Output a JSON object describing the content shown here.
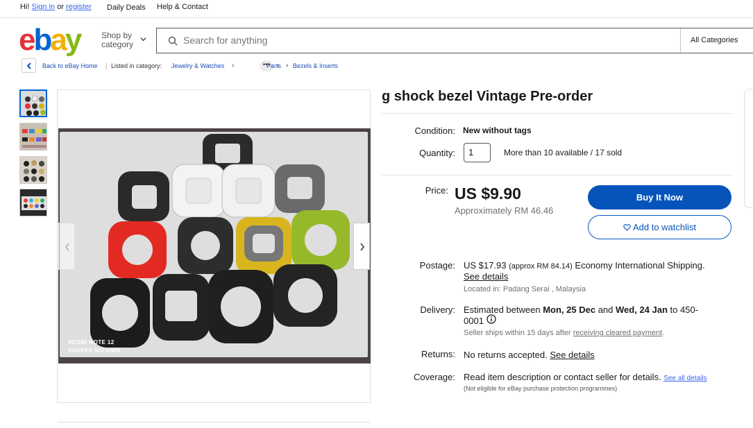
{
  "topbar": {
    "greeting_prefix": "Hi!",
    "sign_in": "Sign in",
    "or": "or",
    "register": "register",
    "daily_deals": "Daily Deals",
    "help_contact": "Help & Contact"
  },
  "header": {
    "shop_by_line1": "Shop by",
    "shop_by_line2": "category",
    "search_placeholder": "Search for anything",
    "category_select": "All Categories"
  },
  "breadcrumb": {
    "back": "Back to eBay Home",
    "listed_in": "Listed in category:",
    "cat1": "Jewelry & Watches",
    "dots": "•••",
    "cat2": "Parts",
    "cat3": "Bezels & Inserts"
  },
  "gallery": {
    "watermark_line1": "REDMI NOTE 12",
    "watermark_line2": "SHOPEE:MIZAN86",
    "thumb_count": 4
  },
  "listing": {
    "title": "g shock bezel Vintage Pre-order",
    "condition_label": "Condition:",
    "condition_value": "New without tags",
    "quantity_label": "Quantity:",
    "quantity_value": "1",
    "availability": "More than 10 available / 17 sold",
    "price_label": "Price:",
    "price": "US $9.90",
    "approx_price": "Approximately RM 46.46",
    "buy_now": "Buy It Now",
    "watchlist": "Add to watchlist",
    "postage_label": "Postage:",
    "postage_price": "US $17.93",
    "postage_approx": "(approx RM 84.14)",
    "postage_method": "Economy International Shipping.",
    "postage_details": "See details",
    "location": "Located in: Padang Serai , Malaysia",
    "delivery_label": "Delivery:",
    "delivery_prefix": "Estimated between",
    "delivery_start": "Mon, 25 Dec",
    "delivery_and": "and",
    "delivery_end": "Wed, 24 Jan",
    "delivery_to": "to 450-",
    "delivery_postcode2": "0001",
    "ships_note_prefix": "Seller ships within 15 days after",
    "ships_note_link": "receiving cleared payment",
    "ships_note_suffix": ".",
    "returns_label": "Returns:",
    "returns_value": "No returns accepted.",
    "returns_details": "See details",
    "coverage_label": "Coverage:",
    "coverage_value": "Read item description or contact seller for details.",
    "coverage_link": "See all details",
    "coverage_note": "(Not eligible for eBay purchase protection programmes)"
  },
  "colors": {
    "ebay_red": "#e53238",
    "ebay_blue": "#0064d2",
    "ebay_yellow": "#f5af02",
    "ebay_green": "#86b817",
    "cta_blue": "#0654ba"
  }
}
